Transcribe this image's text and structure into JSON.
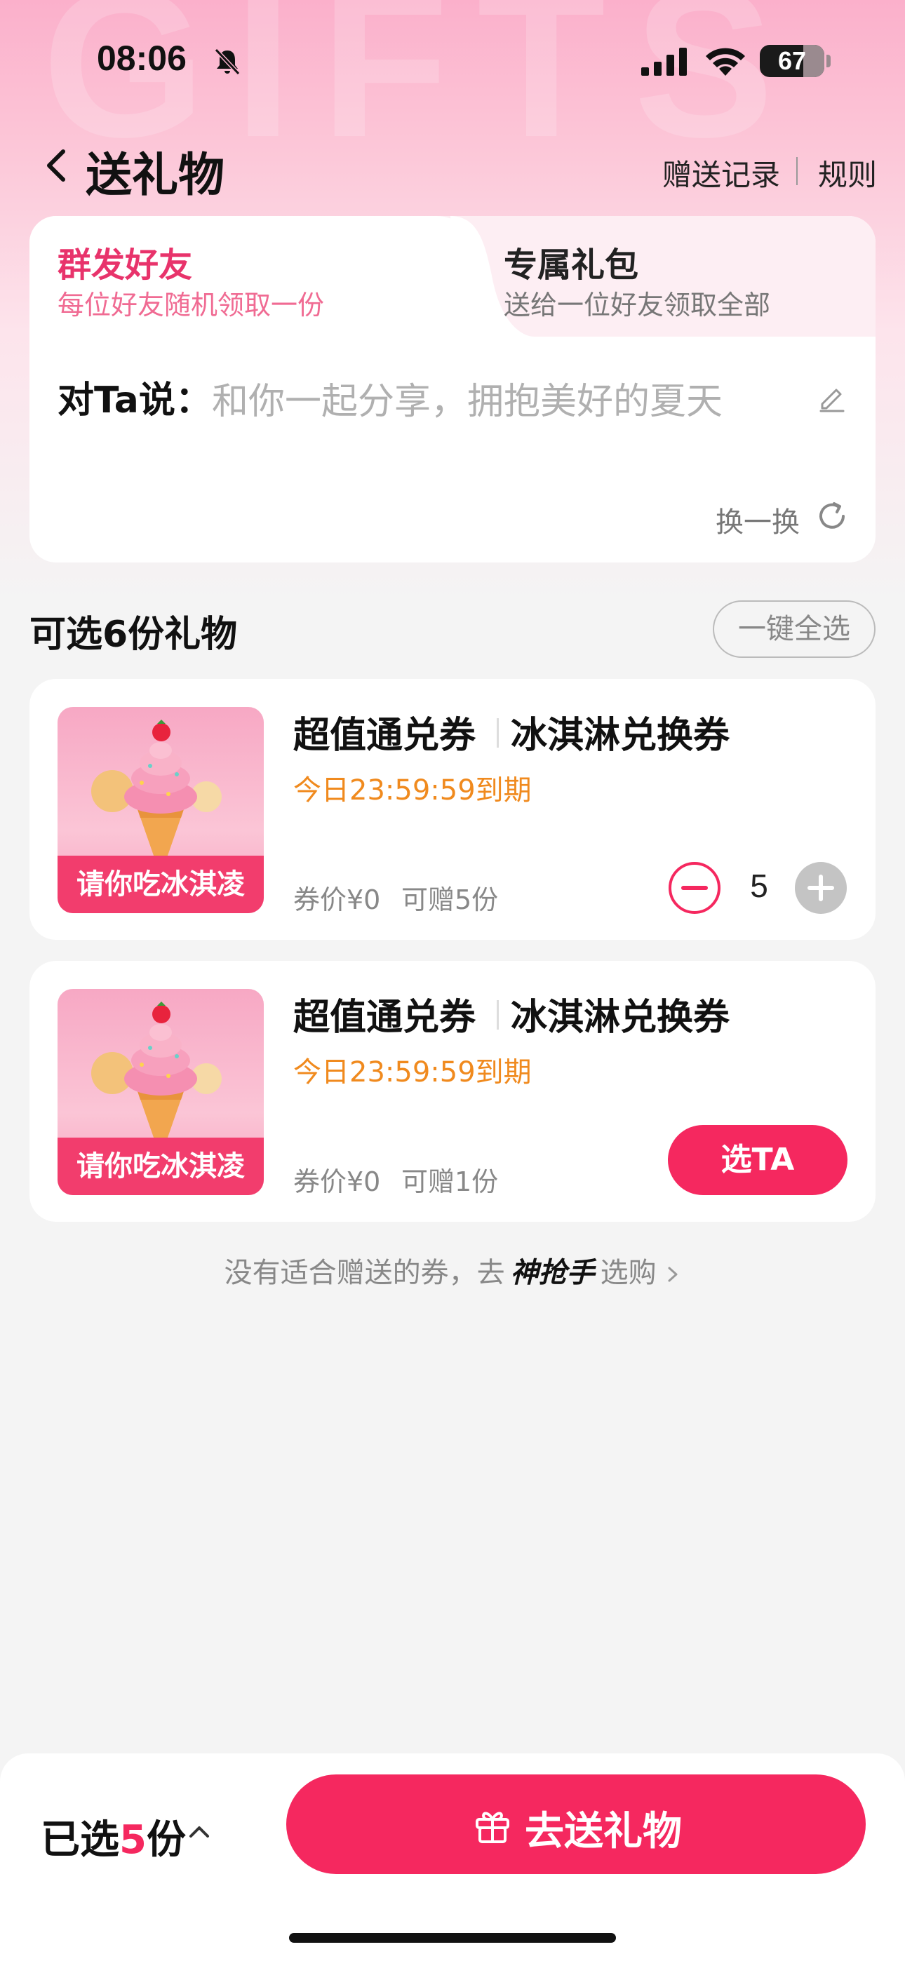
{
  "status_bar": {
    "time": "08:06",
    "battery": "67",
    "battery_level": 0.67
  },
  "header": {
    "title": "送礼物",
    "record_link": "赠送记录",
    "rules_link": "规则",
    "watermark": "GIFTS"
  },
  "tabs": [
    {
      "title": "群发好友",
      "subtitle": "每位好友随机领取一份",
      "active": true
    },
    {
      "title": "专属礼包",
      "subtitle": "送给一位好友领取全部",
      "active": false
    }
  ],
  "message": {
    "label": "对Ta说：",
    "text": "和你一起分享，拥抱美好的夏天",
    "refresh_label": "换一换"
  },
  "section": {
    "title": "可选6份礼物",
    "select_all": "一键全选"
  },
  "gifts": [
    {
      "title_a": "超值通兑券",
      "title_b": "冰淇淋兑换券",
      "expiry": "今日23:59:59到期",
      "price": "券价¥0",
      "qty_text": "可赠5份",
      "quantity": "5",
      "banner": "请你吃冰淇凌",
      "picked": true
    },
    {
      "title_a": "超值通兑券",
      "title_b": "冰淇淋兑换券",
      "expiry": "今日23:59:59到期",
      "price": "券价¥0",
      "qty_text": "可赠1份",
      "button": "选TA",
      "banner": "请你吃冰淇凌",
      "picked": false
    }
  ],
  "hint": {
    "prefix": "没有适合赠送的券，去",
    "brand": "神抢手",
    "suffix": "选购"
  },
  "bottom": {
    "selected_prefix": "已选",
    "selected_count": "5",
    "selected_suffix": "份",
    "send_button": "去送礼物"
  },
  "colors": {
    "accent": "#f5285f",
    "expiry": "#f08a1e",
    "tab_active": "#e8336b"
  }
}
